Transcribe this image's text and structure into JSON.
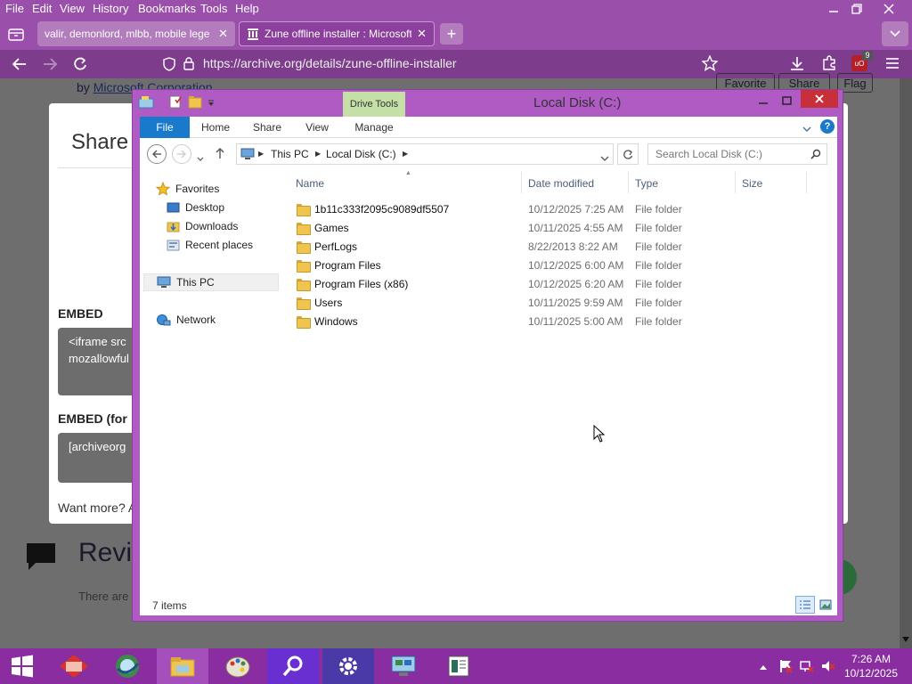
{
  "browser": {
    "menu": [
      "File",
      "Edit",
      "View",
      "History",
      "Bookmarks",
      "Tools",
      "Help"
    ],
    "tabs": [
      {
        "title": "valir, demonlord, mlbb, mobile lege",
        "active": false
      },
      {
        "title": "Zune offline installer : Microsoft",
        "active": true
      }
    ],
    "url": "https://archive.org/details/zune-offline-installer",
    "notification_count": "9",
    "extension_badge": "uO"
  },
  "page": {
    "author_prefix": "by",
    "author": "Microsoft Corporation",
    "top_buttons": [
      "Favorite",
      "Share",
      "Flag"
    ],
    "share_title": "Share",
    "embed_label": "EMBED",
    "embed_code_line1": "<iframe src",
    "embed_code_line2": "mozallowful",
    "embed_wp_label": "EMBED (for",
    "embed_wp_code": "[archiveorg",
    "want_more": "Want more? A",
    "reviews_title": "Revi",
    "reviews_text": "There are"
  },
  "explorer": {
    "title": "Local Disk (C:)",
    "context_tab_group": "Drive Tools",
    "ribbon_tabs": [
      "File",
      "Home",
      "Share",
      "View",
      "Manage"
    ],
    "breadcrumb": [
      "This PC",
      "Local Disk (C:)"
    ],
    "search_placeholder": "Search Local Disk (C:)",
    "nav": {
      "favorites": "Favorites",
      "desktop": "Desktop",
      "downloads": "Downloads",
      "recent": "Recent places",
      "this_pc": "This PC",
      "network": "Network"
    },
    "columns": {
      "name": "Name",
      "date": "Date modified",
      "type": "Type",
      "size": "Size"
    },
    "files": [
      {
        "name": "1b11c333f2095c9089df5507",
        "date": "10/12/2025 7:25 AM",
        "type": "File folder"
      },
      {
        "name": "Games",
        "date": "10/11/2025 4:55 AM",
        "type": "File folder"
      },
      {
        "name": "PerfLogs",
        "date": "8/22/2013 8:22 AM",
        "type": "File folder"
      },
      {
        "name": "Program Files",
        "date": "10/12/2025 6:00 AM",
        "type": "File folder"
      },
      {
        "name": "Program Files (x86)",
        "date": "10/12/2025 6:20 AM",
        "type": "File folder"
      },
      {
        "name": "Users",
        "date": "10/11/2025 9:59 AM",
        "type": "File folder"
      },
      {
        "name": "Windows",
        "date": "10/11/2025 5:00 AM",
        "type": "File folder"
      }
    ],
    "item_count": "7 items"
  },
  "taskbar": {
    "time": "7:26 AM",
    "date": "10/12/2025"
  }
}
